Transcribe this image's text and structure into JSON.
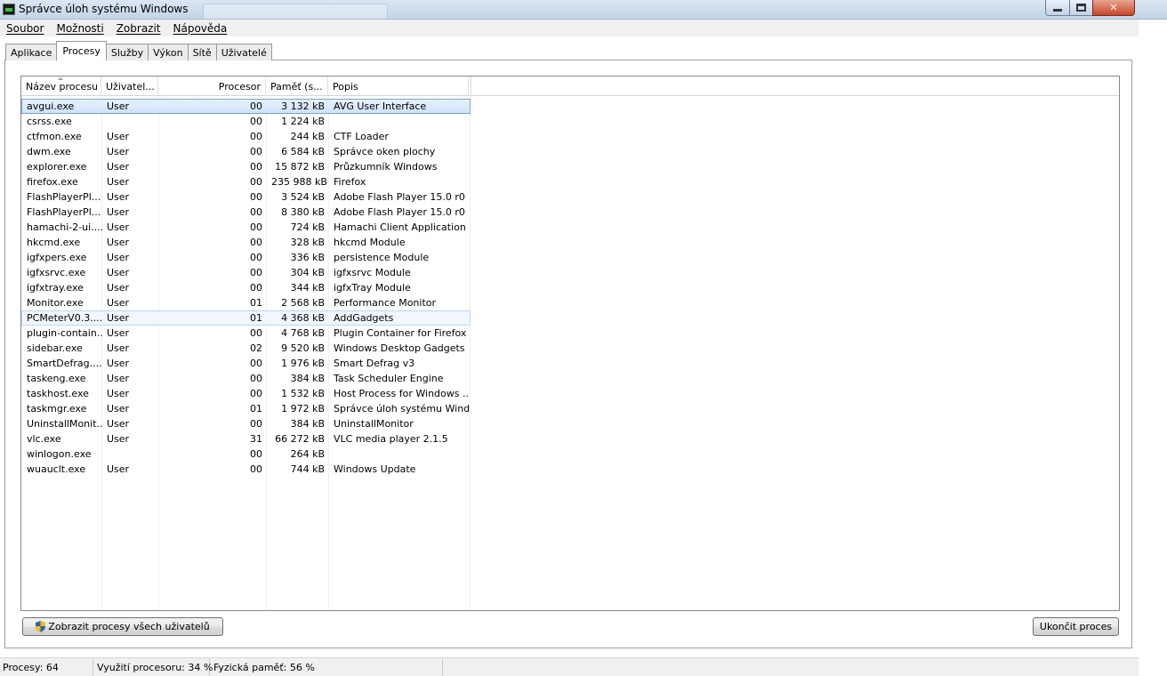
{
  "window": {
    "title": "Správce úloh systému Windows"
  },
  "menu": [
    "Soubor",
    "Možnosti",
    "Zobrazit",
    "Nápověda"
  ],
  "tabs": [
    {
      "label": "Aplikace",
      "active": false
    },
    {
      "label": "Procesy",
      "active": true
    },
    {
      "label": "Služby",
      "active": false
    },
    {
      "label": "Výkon",
      "active": false
    },
    {
      "label": "Sítě",
      "active": false
    },
    {
      "label": "Uživatelé",
      "active": false
    }
  ],
  "columns": {
    "name": "Název procesu",
    "user": "Uživatel...",
    "cpu": "Procesor",
    "memory": "Paměť (s...",
    "description": "Popis"
  },
  "processes": [
    {
      "name": "avgui.exe",
      "user": "User",
      "cpu": "00",
      "memory": "3 132 kB",
      "description": "AVG User Interface",
      "state": "selected"
    },
    {
      "name": "csrss.exe",
      "user": "",
      "cpu": "00",
      "memory": "1 224 kB",
      "description": "",
      "state": ""
    },
    {
      "name": "ctfmon.exe",
      "user": "User",
      "cpu": "00",
      "memory": "244 kB",
      "description": "CTF Loader",
      "state": ""
    },
    {
      "name": "dwm.exe",
      "user": "User",
      "cpu": "00",
      "memory": "6 584 kB",
      "description": "Správce oken plochy",
      "state": ""
    },
    {
      "name": "explorer.exe",
      "user": "User",
      "cpu": "00",
      "memory": "15 872 kB",
      "description": "Průzkumník Windows",
      "state": ""
    },
    {
      "name": "firefox.exe",
      "user": "User",
      "cpu": "00",
      "memory": "235 988 kB",
      "description": "Firefox",
      "state": ""
    },
    {
      "name": "FlashPlayerPl...",
      "user": "User",
      "cpu": "00",
      "memory": "3 524 kB",
      "description": "Adobe Flash Player 15.0 r0",
      "state": ""
    },
    {
      "name": "FlashPlayerPl...",
      "user": "User",
      "cpu": "00",
      "memory": "8 380 kB",
      "description": "Adobe Flash Player 15.0 r0",
      "state": ""
    },
    {
      "name": "hamachi-2-ui....",
      "user": "User",
      "cpu": "00",
      "memory": "724 kB",
      "description": "Hamachi Client Application",
      "state": ""
    },
    {
      "name": "hkcmd.exe",
      "user": "User",
      "cpu": "00",
      "memory": "328 kB",
      "description": "hkcmd Module",
      "state": ""
    },
    {
      "name": "igfxpers.exe",
      "user": "User",
      "cpu": "00",
      "memory": "336 kB",
      "description": "persistence Module",
      "state": ""
    },
    {
      "name": "igfxsrvc.exe",
      "user": "User",
      "cpu": "00",
      "memory": "304 kB",
      "description": "igfxsrvc Module",
      "state": ""
    },
    {
      "name": "igfxtray.exe",
      "user": "User",
      "cpu": "00",
      "memory": "344 kB",
      "description": "igfxTray Module",
      "state": ""
    },
    {
      "name": "Monitor.exe",
      "user": "User",
      "cpu": "01",
      "memory": "2 568 kB",
      "description": "Performance Monitor",
      "state": ""
    },
    {
      "name": "PCMeterV0.3....",
      "user": "User",
      "cpu": "01",
      "memory": "4 368 kB",
      "description": "AddGadgets",
      "state": "hover"
    },
    {
      "name": "plugin-contain...",
      "user": "User",
      "cpu": "00",
      "memory": "4 768 kB",
      "description": "Plugin Container for Firefox",
      "state": ""
    },
    {
      "name": "sidebar.exe",
      "user": "User",
      "cpu": "02",
      "memory": "9 520 kB",
      "description": "Windows Desktop Gadgets",
      "state": ""
    },
    {
      "name": "SmartDefrag....",
      "user": "User",
      "cpu": "00",
      "memory": "1 976 kB",
      "description": "Smart Defrag v3",
      "state": ""
    },
    {
      "name": "taskeng.exe",
      "user": "User",
      "cpu": "00",
      "memory": "384 kB",
      "description": "Task Scheduler Engine",
      "state": ""
    },
    {
      "name": "taskhost.exe",
      "user": "User",
      "cpu": "00",
      "memory": "1 532 kB",
      "description": "Host Process for Windows ...",
      "state": ""
    },
    {
      "name": "taskmgr.exe",
      "user": "User",
      "cpu": "01",
      "memory": "1 972 kB",
      "description": "Správce úloh systému Wind...",
      "state": ""
    },
    {
      "name": "UninstallMonit...",
      "user": "User",
      "cpu": "00",
      "memory": "384 kB",
      "description": "UninstallMonitor",
      "state": ""
    },
    {
      "name": "vlc.exe",
      "user": "User",
      "cpu": "31",
      "memory": "66 272 kB",
      "description": "VLC media player 2.1.5",
      "state": ""
    },
    {
      "name": "winlogon.exe",
      "user": "",
      "cpu": "00",
      "memory": "264 kB",
      "description": "",
      "state": ""
    },
    {
      "name": "wuauclt.exe",
      "user": "User",
      "cpu": "00",
      "memory": "744 kB",
      "description": "Windows Update",
      "state": ""
    }
  ],
  "buttons": {
    "show_all": "Zobrazit procesy všech uživatelů",
    "end_process": "Ukončit proces"
  },
  "status": {
    "processes": "Procesy: 64",
    "cpu": "Využití procesoru: 34 %",
    "memory": "Fyzická paměť: 56 %"
  }
}
